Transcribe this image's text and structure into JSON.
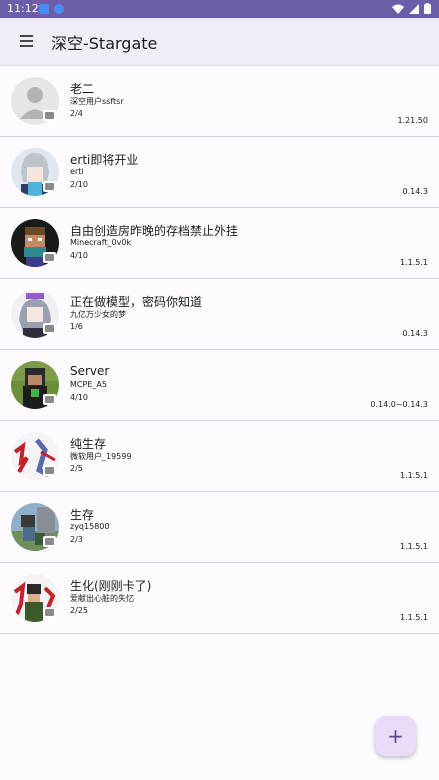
{
  "status_bar": {
    "time": "11:12"
  },
  "app_bar": {
    "title": "深空-Stargate",
    "menu_icon": "menu-icon"
  },
  "servers": [
    {
      "name": "老二",
      "owner": "深空用户ssftsr",
      "players": "2/4",
      "version": "1.21.50"
    },
    {
      "name": "erti即将开业",
      "owner": "erti",
      "players": "2/10",
      "version": "0.14.3"
    },
    {
      "name": "自由创造房昨晚的存档禁止外挂",
      "owner": "Minecraft_0v0k",
      "players": "4/10",
      "version": "1.1.5.1"
    },
    {
      "name": "正在做模型，密码你知道",
      "owner": "九亿万少女的梦",
      "players": "1/6",
      "version": "0.14.3"
    },
    {
      "name": "Server",
      "owner": "MCPE_A5",
      "players": "4/10",
      "version": "0.14.0~0.14.3"
    },
    {
      "name": "纯生存",
      "owner": "微软用户_19599",
      "players": "2/5",
      "version": "1.1.5.1"
    },
    {
      "name": "生存",
      "owner": "zyq15800",
      "players": "2/3",
      "version": "1.1.5.1"
    },
    {
      "name": "生化(刚刚卡了)",
      "owner": "爱献出心脏的失忆",
      "players": "2/25",
      "version": "1.1.5.1"
    }
  ],
  "fab": {
    "label": "+"
  }
}
